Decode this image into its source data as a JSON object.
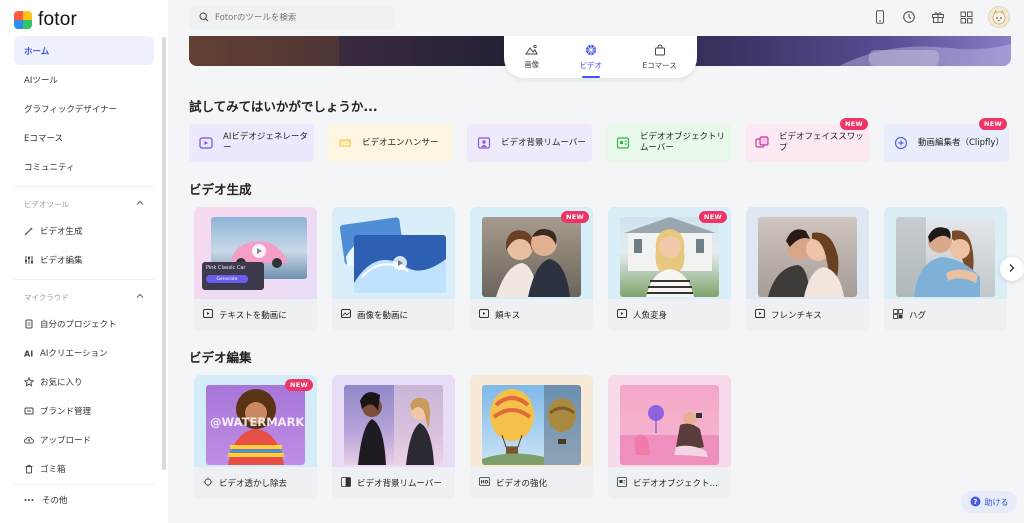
{
  "brand": {
    "name": "fotor"
  },
  "sidebar": {
    "nav": [
      {
        "label": "ホーム",
        "active": true
      },
      {
        "label": "AIツール"
      },
      {
        "label": "グラフィックデザイナー"
      },
      {
        "label": "Eコマース"
      },
      {
        "label": "コミュニティ"
      }
    ],
    "video_tools": {
      "title": "ビデオツール",
      "items": [
        {
          "label": "ビデオ生成",
          "icon": "magic-wand-icon"
        },
        {
          "label": "ビデオ編集",
          "icon": "sliders-icon"
        }
      ]
    },
    "my_cloud": {
      "title": "マイクラウド",
      "items": [
        {
          "label": "自分のプロジェクト",
          "icon": "document-icon"
        },
        {
          "label": "AIクリエーション",
          "icon": "ai-icon"
        },
        {
          "label": "お気に入り",
          "icon": "star-icon"
        },
        {
          "label": "ブランド管理",
          "icon": "brand-icon"
        },
        {
          "label": "アップロード",
          "icon": "cloud-upload-icon"
        },
        {
          "label": "ゴミ箱",
          "icon": "trash-icon"
        }
      ]
    },
    "more_label": "その他"
  },
  "header": {
    "search_placeholder": "Fotorのツールを検索"
  },
  "tabs": [
    {
      "label": "画像",
      "icon": "image-icon"
    },
    {
      "label": "ビデオ",
      "icon": "video-icon",
      "active": true
    },
    {
      "label": "Eコマース",
      "icon": "shopping-bag-icon"
    }
  ],
  "try_section": {
    "title": "試してみてはいかがでしょうか...",
    "items": [
      {
        "label": "AIビデオジェネレーター",
        "color": "#ece8fd",
        "icon_color": "#7b4de8",
        "badge": ""
      },
      {
        "label": "ビデオエンハンサー",
        "color": "#fdf6e2",
        "icon_color": "#f3b72b",
        "badge": ""
      },
      {
        "label": "ビデオ背景リムーバー",
        "color": "#efe9fb",
        "icon_color": "#8a55e0",
        "badge": ""
      },
      {
        "label": "ビデオオブジェクトリムーバー",
        "color": "#e8f8ea",
        "icon_color": "#33b34b",
        "badge": ""
      },
      {
        "label": "ビデオフェイススワップ",
        "color": "#fde9f4",
        "icon_color": "#c73aa5",
        "badge": "NEW"
      },
      {
        "label": "動画編集者（Clipfly）",
        "color": "#e9edfb",
        "icon_color": "#5366e6",
        "badge": "NEW"
      }
    ]
  },
  "video_generation": {
    "title": "ビデオ生成",
    "cards": [
      {
        "label": "テキストを動画に",
        "bg": "#f6dcef",
        "badge": "",
        "prompt_text": "Pink Classic Car",
        "generate_label": "Generate"
      },
      {
        "label": "画像を動画に",
        "bg": "#d9eef9",
        "badge": ""
      },
      {
        "label": "頬キス",
        "bg": "#d6eef7",
        "badge": "NEW"
      },
      {
        "label": "人魚変身",
        "bg": "#d8eef8",
        "badge": "NEW"
      },
      {
        "label": "フレンチキス",
        "bg": "#dfe8f2",
        "badge": ""
      },
      {
        "label": "ハグ",
        "bg": "#dbeef6",
        "badge": ""
      }
    ]
  },
  "video_editing": {
    "title": "ビデオ編集",
    "cards": [
      {
        "label": "ビデオ透かし除去",
        "bg": "#d4ecf7",
        "badge": "NEW",
        "watermark": "@WATERMARK"
      },
      {
        "label": "ビデオ背景リムーバー",
        "bg": "#e8dcf6",
        "badge": ""
      },
      {
        "label": "ビデオの強化",
        "bg": "#f8ead9",
        "badge": ""
      },
      {
        "label": "ビデオオブジェクト…",
        "bg": "#f7dbeb",
        "badge": ""
      }
    ]
  },
  "help_label": "助ける"
}
